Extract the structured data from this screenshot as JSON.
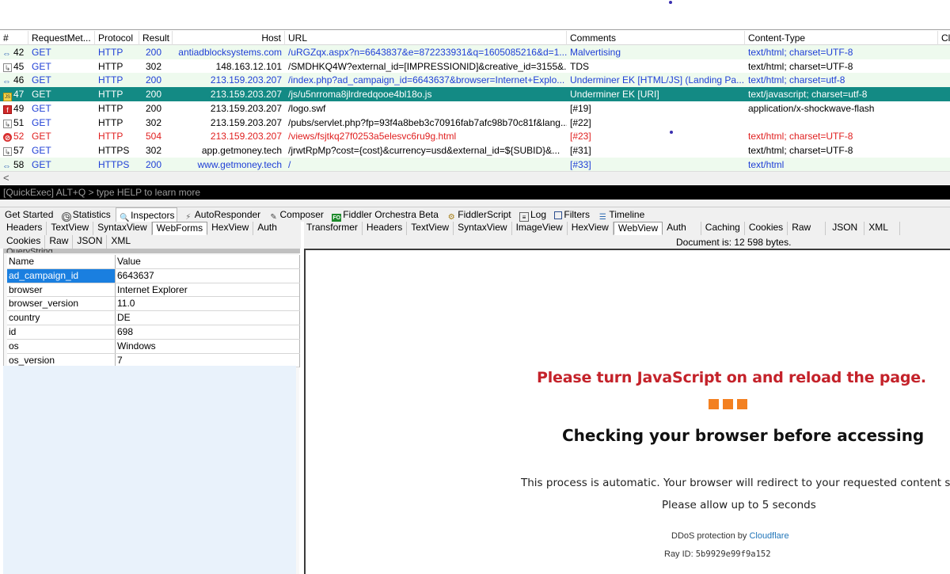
{
  "sessions": {
    "columns": [
      "#",
      "RequestMet...",
      "Protocol",
      "Result",
      "Host",
      "URL",
      "Comments",
      "Content-Type",
      "Cl"
    ],
    "rows": [
      {
        "id": "42",
        "icon": "arrows-icon",
        "method": "GET",
        "protocol": "HTTP",
        "result": "200",
        "host": "antiadblocksystems.com",
        "url": "/uRGZqx.aspx?n=6643837&e=872233931&q=1605085216&d=1...",
        "comments": "Malvertising",
        "content_type": "text/html; charset=UTF-8"
      },
      {
        "id": "45",
        "icon": "redirect-icon",
        "method": "GET",
        "protocol": "HTTP",
        "result": "302",
        "host": "148.163.12.101",
        "url": "/SMDHKQ4W?external_id=[IMPRESSIONID]&creative_id=3155&...",
        "comments": "TDS",
        "content_type": "text/html; charset=UTF-8"
      },
      {
        "id": "46",
        "icon": "arrows-icon",
        "method": "GET",
        "protocol": "HTTP",
        "result": "200",
        "host": "213.159.203.207",
        "url": "/index.php?ad_campaign_id=6643637&browser=Internet+Explo...",
        "comments": "Underminer EK [HTML/JS] (Landing Pa...",
        "content_type": "text/html; charset=utf-8"
      },
      {
        "id": "47",
        "icon": "script-icon",
        "method": "GET",
        "protocol": "HTTP",
        "result": "200",
        "host": "213.159.203.207",
        "url": "/js/u5nrroma8jlrdredqooe4bl18o.js",
        "comments": "Underminer EK [URI]",
        "content_type": "text/javascript; charset=utf-8"
      },
      {
        "id": "49",
        "icon": "flash-icon",
        "method": "GET",
        "protocol": "HTTP",
        "result": "200",
        "host": "213.159.203.207",
        "url": "/logo.swf",
        "comments": "[#19]",
        "content_type": "application/x-shockwave-flash"
      },
      {
        "id": "51",
        "icon": "redirect-icon",
        "method": "GET",
        "protocol": "HTTP",
        "result": "302",
        "host": "213.159.203.207",
        "url": "/pubs/servlet.php?fp=93f4a8beb3c70916fab7afc98b70c81f&lang...",
        "comments": "[#22]",
        "content_type": ""
      },
      {
        "id": "52",
        "icon": "error-icon",
        "method": "GET",
        "protocol": "HTTP",
        "result": "504",
        "host": "213.159.203.207",
        "url": "/views/fsjtkq27f0253a5elesvc6ru9g.html",
        "comments": "[#23]",
        "content_type": "text/html; charset=UTF-8"
      },
      {
        "id": "57",
        "icon": "redirect-icon",
        "method": "GET",
        "protocol": "HTTPS",
        "result": "302",
        "host": "app.getmoney.tech",
        "url": "/jrwtRpMp?cost={cost}&currency=usd&external_id=${SUBID}&...",
        "comments": "[#31]",
        "content_type": "text/html; charset=UTF-8"
      },
      {
        "id": "58",
        "icon": "arrows-icon",
        "method": "GET",
        "protocol": "HTTPS",
        "result": "200",
        "host": "www.getmoney.tech",
        "url": "/",
        "comments": "[#33]",
        "content_type": "text/html"
      }
    ]
  },
  "quickexec": {
    "text": "[QuickExec] ALT+Q > type HELP to learn more"
  },
  "main_tabs": [
    "Get Started",
    "Statistics",
    "Inspectors",
    "AutoResponder",
    "Composer",
    "Fiddler Orchestra Beta",
    "FiddlerScript",
    "Log",
    "Filters",
    "Timeline"
  ],
  "request_tabs": {
    "row1": [
      "Headers",
      "TextView",
      "SyntaxView",
      "WebForms",
      "HexView",
      "Auth"
    ],
    "row2": [
      "Cookies",
      "Raw",
      "JSON",
      "XML"
    ]
  },
  "response_tabs": {
    "row1": [
      "Transformer",
      "Headers",
      "TextView",
      "SyntaxView",
      "ImageView",
      "HexView",
      "WebView",
      "Auth",
      "Caching",
      "Cookies",
      "Raw",
      "JSON",
      "XML"
    ],
    "doc_info": "Document is: 12 598 bytes."
  },
  "querystring": {
    "caption": "QueryString",
    "header": {
      "name": "Name",
      "value": "Value"
    },
    "rows": [
      {
        "name": "ad_campaign_id",
        "value": "6643637"
      },
      {
        "name": "browser",
        "value": "Internet Explorer"
      },
      {
        "name": "browser_version",
        "value": "11.0"
      },
      {
        "name": "country",
        "value": "DE"
      },
      {
        "name": "id",
        "value": "698"
      },
      {
        "name": "os",
        "value": "Windows"
      },
      {
        "name": "os_version",
        "value": "7"
      }
    ]
  },
  "webview": {
    "title": "Please turn JavaScript on and reload the page.",
    "checking": "Checking your browser before accessing",
    "auto": "This process is automatic. Your browser will redirect to your requested content shortly.",
    "allow": "Please allow up to 5 seconds",
    "ddos_prefix": "DDoS protection by ",
    "ddos_link": "Cloudflare",
    "ray_prefix": "Ray ID: ",
    "ray_id": "5b9929e99f9a152"
  },
  "colors": {
    "selected_row": "#138a84",
    "success_row": "#eefaee",
    "error_text": "#e02020",
    "link_blue": "#1f3fd6",
    "brand_orange": "#f38020"
  }
}
